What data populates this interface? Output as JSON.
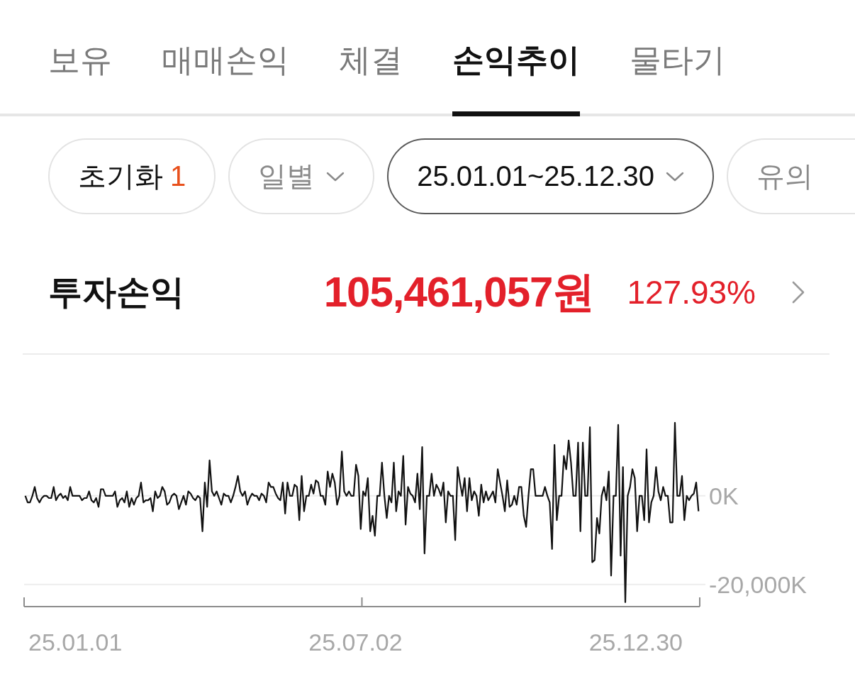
{
  "tabs": [
    {
      "label": "보유",
      "selected": false
    },
    {
      "label": "매매손익",
      "selected": false
    },
    {
      "label": "체결",
      "selected": false
    },
    {
      "label": "손익추이",
      "selected": true
    },
    {
      "label": "물타기",
      "selected": false
    }
  ],
  "filters": [
    {
      "kind": "reset",
      "label": "초기화",
      "count": "1",
      "selected": false
    },
    {
      "kind": "dropdown",
      "label": "일별",
      "selected": false
    },
    {
      "kind": "dropdown",
      "label": "25.01.01~25.12.30",
      "selected": true
    },
    {
      "kind": "chip",
      "label": "유의",
      "selected": false
    }
  ],
  "summary": {
    "label": "투자손익",
    "amount": "105,461,057원",
    "rate": "127.93%"
  },
  "chart": {
    "x_labels": [
      "25.01.01",
      "25.07.02",
      "25.12.30"
    ],
    "chart_data": {
      "type": "line",
      "ylim": [
        -25000,
        32000
      ],
      "yticks": [
        {
          "value": 0,
          "label": "0K"
        },
        {
          "value": -20000,
          "label": "-20,000K"
        }
      ],
      "values": [
        0,
        -1500,
        -1500,
        0,
        2000,
        -500,
        -1500,
        -500,
        0,
        0,
        -500,
        -500,
        2000,
        -1000,
        0,
        500,
        -500,
        0,
        -1000,
        2000,
        0,
        0,
        0,
        0,
        -1000,
        -500,
        -500,
        1000,
        -1000,
        -1500,
        -500,
        -2500,
        1500,
        1500,
        0,
        0,
        0,
        0,
        1000,
        -2500,
        -1000,
        -500,
        -1500,
        1000,
        -2500,
        -500,
        -2000,
        -500,
        0,
        3000,
        -1500,
        -1000,
        -1000,
        -500,
        -3500,
        1000,
        -500,
        0,
        2000,
        1000,
        -2000,
        -1500,
        0,
        500,
        0,
        -3000,
        -1500,
        0,
        -2000,
        1000,
        500,
        -500,
        -1000,
        0,
        -500,
        -8000,
        3000,
        -2500,
        8000,
        1000,
        0,
        1000,
        -500,
        -2000,
        500,
        0,
        0,
        -1500,
        0,
        2000,
        4500,
        1000,
        0,
        1000,
        -2000,
        -500,
        500,
        0,
        0,
        -1000,
        500,
        0,
        -1500,
        3000,
        2000,
        2000,
        500,
        -500,
        -1000,
        3000,
        -4000,
        3000,
        0,
        0,
        2500,
        2000,
        -5500,
        4500,
        -3500,
        0,
        0,
        2500,
        500,
        3500,
        3000,
        0,
        0,
        -2000,
        5500,
        2000,
        5000,
        3000,
        -2000,
        0,
        10000,
        1000,
        0,
        1000,
        0,
        0,
        7000,
        4500,
        -7500,
        1000,
        0,
        4000,
        -8000,
        -4500,
        -9000,
        0,
        0,
        7500,
        0,
        -5000,
        0,
        -1500,
        7500,
        -3500,
        1000,
        0,
        9000,
        -6500,
        2000,
        500,
        0,
        -1500,
        5000,
        -3000,
        11000,
        -13000,
        0,
        0,
        5000,
        0,
        2500,
        1500,
        0,
        3000,
        -6000,
        1000,
        0,
        0,
        -10000,
        6500,
        3000,
        0,
        4000,
        -3500,
        4000,
        -1000,
        1000,
        0,
        -4500,
        2500,
        -1500,
        1000,
        -1000,
        0,
        1000,
        -1500,
        6000,
        3000,
        0,
        -3500,
        3500,
        -2500,
        -2000,
        0,
        -2000,
        2000,
        2000,
        -4500,
        -7000,
        0,
        6000,
        6000,
        0,
        0,
        0,
        0,
        2000,
        0,
        -1500,
        -12000,
        11500,
        -5500,
        0,
        0,
        9000,
        6000,
        12500,
        7500,
        0,
        0,
        12000,
        -8000,
        12000,
        0,
        0,
        15500,
        -15000,
        -14500,
        -5000,
        -8500,
        0,
        2000,
        -1000,
        5500,
        -18000,
        0,
        0,
        16000,
        -13500,
        6500,
        -24000,
        0,
        2000,
        6000,
        4000,
        -8000,
        0,
        0,
        -5500,
        10500,
        -6000,
        -1500,
        0,
        6500,
        1000,
        -1000,
        2000,
        0,
        0,
        -6000,
        -6000,
        16500,
        0,
        0,
        4500,
        -5500,
        0,
        -1000,
        0,
        500,
        3000,
        -3500
      ]
    }
  }
}
